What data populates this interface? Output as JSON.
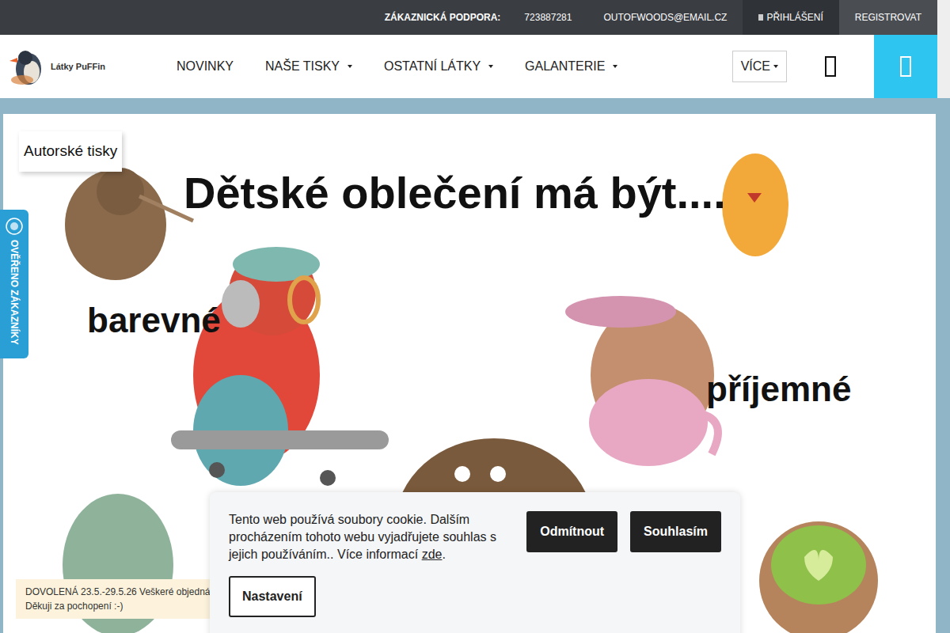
{
  "top_bar": {
    "support_label": "ZÁKAZNICKÁ PODPORA:",
    "phone": "723887281",
    "email": "OUTOFWOODS@EMAIL.CZ",
    "login": "PŘIHLÁŠENÍ",
    "register": "REGISTROVAT"
  },
  "logo": {
    "text": "Látky PuFFin"
  },
  "nav": [
    {
      "label": "NOVINKY",
      "dropdown": false
    },
    {
      "label": "NAŠE TISKY",
      "dropdown": true
    },
    {
      "label": "OSTATNÍ LÁTKY",
      "dropdown": true
    },
    {
      "label": "GALANTERIE",
      "dropdown": true
    }
  ],
  "more": "VÍCE",
  "banner": {
    "tag": "Autorské tisky",
    "headline": "Dětské oblečení má být....",
    "words": [
      "barevné",
      "příjemné"
    ]
  },
  "verified_tab": "OVĚŘENO ZÁKAZNÍKY",
  "notice": {
    "lines": [
      "DOVOLENÁ 23.5.-29.5.26 Veškeré objedná",
      "Děkuji za pochopení :-)"
    ]
  },
  "cookie": {
    "text": "Tento web používá soubory cookie. Dalším procházením tohoto webu vyjadřujete souhlas s jejich používáním.. Více informací ",
    "link": "zde",
    "after": ".",
    "buttons": [
      "Odmítnout",
      "Souhlasím"
    ],
    "settings": "Nastavení"
  }
}
